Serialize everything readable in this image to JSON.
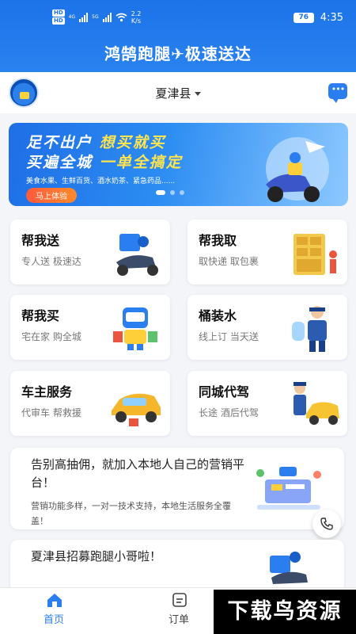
{
  "status_bar": {
    "hd1": "HD",
    "hd2": "HD",
    "net1": "4G",
    "net2": "5G",
    "speed_value": "2.2",
    "speed_unit": "K/s",
    "battery": "76",
    "time": "4:35"
  },
  "header": {
    "title": "鸿鹄跑腿✈极速送达"
  },
  "location": {
    "city": "夏津县"
  },
  "banner": {
    "line1_white": "足不出户 ",
    "line1_yellow": "想买就买",
    "line2_white": "买遍全城 ",
    "line2_yellow": "一单全搞定",
    "subtitle": "美食水果、生鲜百货、酒水奶茶、紧急药品......",
    "button": "马上体验"
  },
  "services": [
    {
      "title": "帮我送",
      "subtitle": "专人送 极速达",
      "icon": "delivery-scooter-icon"
    },
    {
      "title": "帮我取",
      "subtitle": "取快递 取包裹",
      "icon": "parcel-locker-icon"
    },
    {
      "title": "帮我买",
      "subtitle": "宅在家 购全城",
      "icon": "shopping-robot-icon"
    },
    {
      "title": "桶装水",
      "subtitle": "线上订 当天送",
      "icon": "water-delivery-icon"
    },
    {
      "title": "车主服务",
      "subtitle": "代审车 帮救援",
      "icon": "car-repair-icon"
    },
    {
      "title": "同城代驾",
      "subtitle": "长途 酒后代驾",
      "icon": "driver-car-icon"
    }
  ],
  "promos": [
    {
      "title": "告别高抽佣，就加入本地人自己的营销平台！",
      "text": "营销功能多样，一对一技术支持，本地生活服务全覆盖！"
    },
    {
      "title": "夏津县招募跑腿小哥啦！",
      "text": ""
    }
  ],
  "tabs": [
    {
      "label": "首页"
    },
    {
      "label": "订单"
    }
  ],
  "watermark": "下载鸟资源",
  "colors": {
    "primary": "#1c73e8",
    "accent_yellow": "#ffe44d",
    "button_orange": "#ff6a34"
  }
}
